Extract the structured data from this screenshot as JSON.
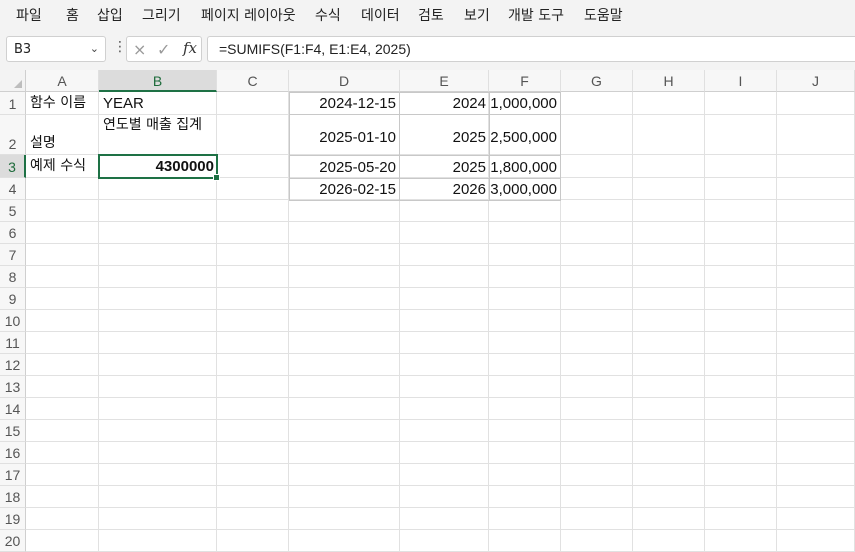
{
  "menu": [
    "파일",
    "홈",
    "삽입",
    "그리기",
    "페이지 레이아웃",
    "수식",
    "데이터",
    "검토",
    "보기",
    "개발 도구",
    "도움말"
  ],
  "name_box": "B3",
  "formula": "=SUMIFS(F1:F4, E1:E4, 2025)",
  "formula_icons": {
    "cancel": "×",
    "enter": "✓",
    "fx": "fx"
  },
  "columns": [
    "A",
    "B",
    "C",
    "D",
    "E",
    "F",
    "G",
    "H",
    "I",
    "J"
  ],
  "rows": [
    "1",
    "2",
    "3",
    "4",
    "5",
    "6",
    "7",
    "8",
    "9",
    "10",
    "11",
    "12",
    "13",
    "14",
    "15",
    "16",
    "17",
    "18",
    "19",
    "20"
  ],
  "cells": {
    "A1": "함수 이름",
    "B1": "YEAR",
    "A2": "설명",
    "B2": "연도별 매출 집계",
    "A3": "예제 수식",
    "B3": "4300000",
    "D1": "2024-12-15",
    "E1": "2024",
    "F1": "1,000,000",
    "D2": "2025-01-10",
    "E2": "2025",
    "F2": "2,500,000",
    "D3": "2025-05-20",
    "E3": "2025",
    "F3": "1,800,000",
    "D4": "2026-02-15",
    "E4": "2026",
    "F4": "3,000,000"
  },
  "active_cell": "B3",
  "colors": {
    "accent": "#1e7145"
  }
}
